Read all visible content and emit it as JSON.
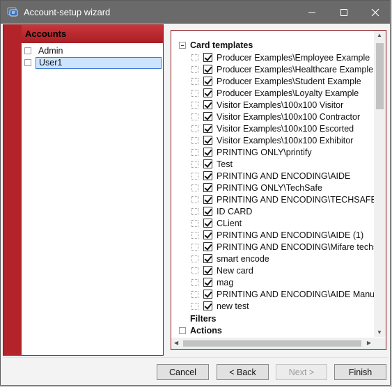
{
  "window": {
    "title": "Account-setup wizard",
    "minimize_glyph": "—",
    "maximize_glyph": "☐",
    "close_glyph": "✕"
  },
  "accounts": {
    "header": "Accounts",
    "items": [
      {
        "label": "Admin",
        "selected": false
      },
      {
        "label": "User1",
        "selected": true
      }
    ]
  },
  "templates": {
    "groups": [
      {
        "label": "Card templates",
        "expanded": true,
        "items": [
          {
            "label": "Producer Examples\\Employee Example",
            "checked": true
          },
          {
            "label": "Producer Examples\\Healthcare Example",
            "checked": true
          },
          {
            "label": "Producer Examples\\Student Example",
            "checked": true
          },
          {
            "label": "Producer Examples\\Loyalty Example",
            "checked": true
          },
          {
            "label": "Visitor Examples\\100x100 Visitor",
            "checked": true
          },
          {
            "label": "Visitor Examples\\100x100 Contractor",
            "checked": true
          },
          {
            "label": "Visitor Examples\\100x100 Escorted",
            "checked": true
          },
          {
            "label": "Visitor Examples\\100x100 Exhibitor",
            "checked": true
          },
          {
            "label": "PRINTING ONLY\\printify",
            "checked": true
          },
          {
            "label": "Test",
            "checked": true
          },
          {
            "label": "PRINTING AND ENCODING\\AIDE",
            "checked": true
          },
          {
            "label": "PRINTING ONLY\\TechSafe",
            "checked": true
          },
          {
            "label": "PRINTING AND ENCODING\\TECHSAFE",
            "checked": true
          },
          {
            "label": "ID CARD",
            "checked": true
          },
          {
            "label": "CLient",
            "checked": true
          },
          {
            "label": "PRINTING AND ENCODING\\AIDE (1)",
            "checked": true
          },
          {
            "label": "PRINTING AND ENCODING\\Mifare techsafe",
            "checked": true
          },
          {
            "label": "smart encode",
            "checked": true
          },
          {
            "label": "New card",
            "checked": true
          },
          {
            "label": "mag",
            "checked": true
          },
          {
            "label": "PRINTING AND ENCODING\\AIDE Manual",
            "checked": true
          },
          {
            "label": "new test",
            "checked": true
          }
        ]
      },
      {
        "label": "Filters",
        "expanded": false,
        "items": []
      },
      {
        "label": "Actions",
        "expanded": false,
        "items": []
      }
    ]
  },
  "buttons": {
    "cancel": "Cancel",
    "back": "< Back",
    "next": "Next >",
    "finish": "Finish"
  }
}
